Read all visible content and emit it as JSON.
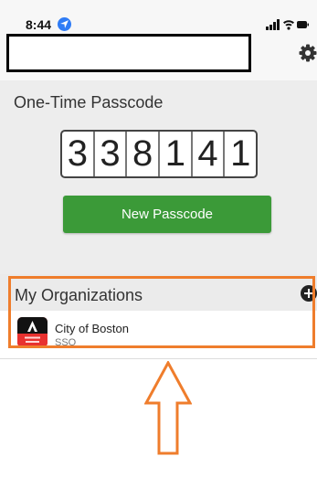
{
  "status_bar": {
    "time": "8:44",
    "location_icon": "location-arrow-icon",
    "signal_icon": "cellular-signal-icon",
    "wifi_icon": "wifi-icon",
    "battery_icon": "battery-icon"
  },
  "header": {
    "settings_icon": "gear-icon"
  },
  "otp": {
    "title": "One-Time Passcode",
    "digits": [
      "3",
      "3",
      "8",
      "1",
      "4",
      "1"
    ],
    "new_button_label": "New Passcode",
    "button_color": "#3b9a38"
  },
  "organizations": {
    "title": "My Organizations",
    "add_icon": "plus-circle-icon",
    "items": [
      {
        "name": "City of Boston",
        "type": "SSO",
        "logo": "access-boston-logo",
        "logo_color": "#e8312f",
        "logo_lettering": [
          "Access",
          "Boston"
        ]
      }
    ]
  },
  "annotations": {
    "highlight_color": "#ef7d2c",
    "arrow": "up-arrow-icon"
  }
}
